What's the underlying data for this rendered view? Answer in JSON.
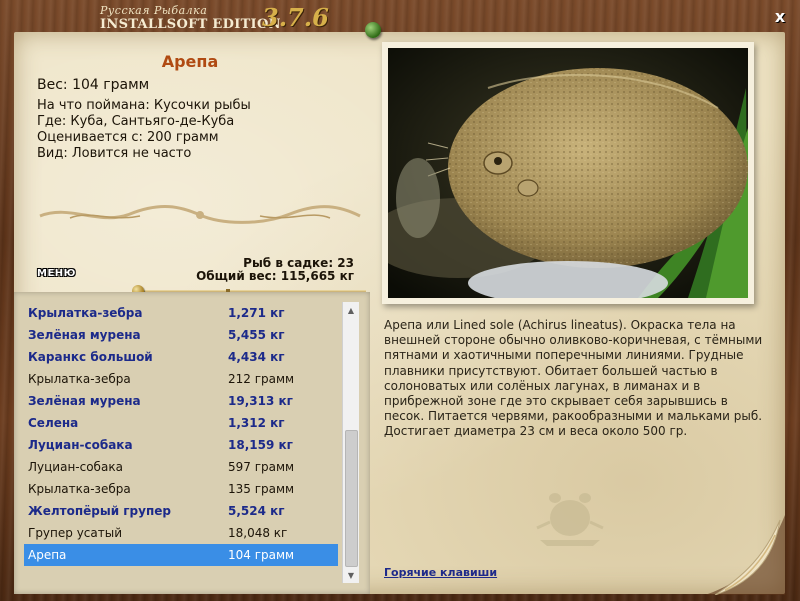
{
  "window": {
    "title_top": "Русская Рыбалка",
    "title_bottom": "INSTALLSOFT EDITION",
    "version": "3.7.6",
    "close_label": "x"
  },
  "fish": {
    "name": "Арепа",
    "weight_line": "Вес: 104 грамм",
    "caught_on": "На что поймана: Кусочки рыбы",
    "location": "Где: Куба, Сантьяго-де-Куба",
    "valued_from": "Оценивается с: 200 грамм",
    "kind": "Вид: Ловится не часто"
  },
  "cage": {
    "count": "Рыб в садке: 23",
    "total": "Общий вес: 115,665 кг"
  },
  "menu_label": "МЕНЮ",
  "catch_list": [
    {
      "name": "Крылатка-зебра",
      "weight": "1,271 кг",
      "bold": true
    },
    {
      "name": "Зелёная мурена",
      "weight": "5,455 кг",
      "bold": true
    },
    {
      "name": "Каранкс большой",
      "weight": "4,434 кг",
      "bold": true
    },
    {
      "name": "Крылатка-зебра",
      "weight": "212 грамм",
      "bold": false
    },
    {
      "name": "Зелёная мурена",
      "weight": "19,313 кг",
      "bold": true
    },
    {
      "name": "Селена",
      "weight": "1,312 кг",
      "bold": true
    },
    {
      "name": "Луциан-собака",
      "weight": "18,159 кг",
      "bold": true
    },
    {
      "name": "Луциан-собака",
      "weight": "597 грамм",
      "bold": false
    },
    {
      "name": "Крылатка-зебра",
      "weight": "135 грамм",
      "bold": false
    },
    {
      "name": "Желтопёрый групер",
      "weight": "5,524 кг",
      "bold": true
    },
    {
      "name": "Групер усатый",
      "weight": "18,048 кг",
      "bold": false
    },
    {
      "name": "Арепа",
      "weight": "104 грамм",
      "bold": false,
      "selected": true
    }
  ],
  "description": "Арепа или Lined sole (Achirus lineatus). Окраска тела на внешней стороне обычно оливково-коричневая, с тёмными пятнами и хаотичными поперечными линиями. Грудные плавники присутствуют. Обитает большей частью в солоноватых или солёных лагунах, в лиманах и в прибрежной зоне где это скрывает себя зарывшись в песок. Питается червями, ракообразными и мальками рыб. Достигает диаметра 23 см и веса около 500 гр.",
  "hotkeys_label": "Горячие клавиши",
  "colors": {
    "accent_name": "#b04a12",
    "bold_row": "#1c2a8a",
    "selection": "#3a8ee6",
    "paper": "#ede2c2",
    "wood": "#6b3c1e",
    "version_gold": "#d7b04a"
  },
  "icons": {
    "close": "close-icon",
    "pin": "pin-icon",
    "scroll_up": "chevron-up-icon",
    "scroll_down": "chevron-down-icon",
    "watermark": "catfish-silhouette-icon"
  }
}
